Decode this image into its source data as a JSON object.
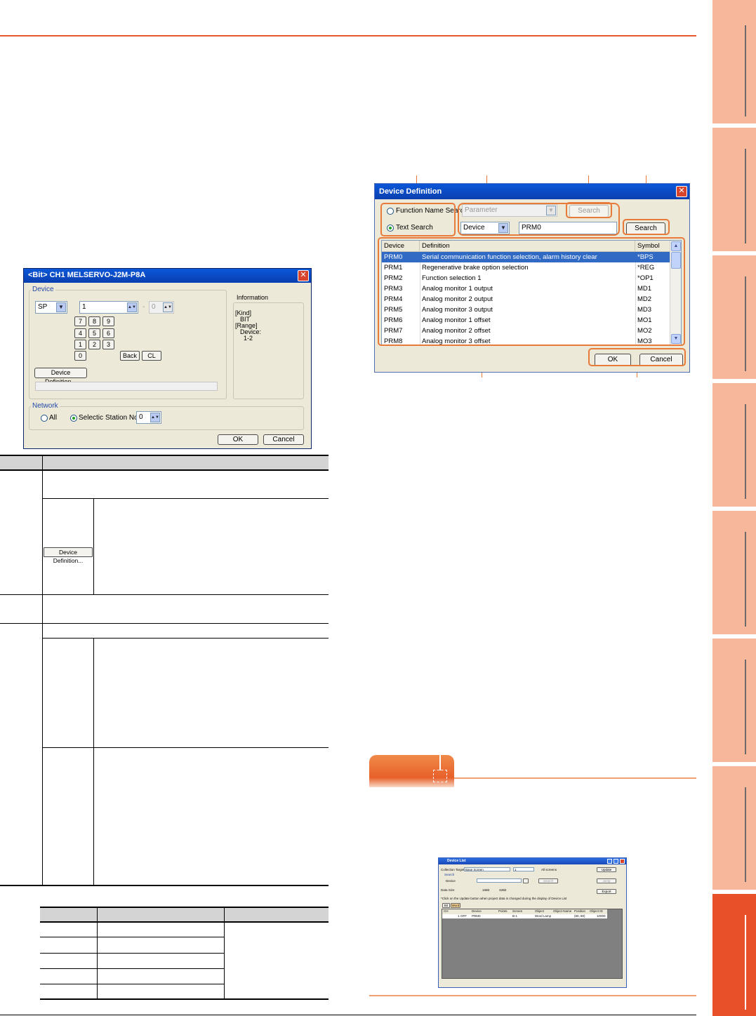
{
  "bit_dialog": {
    "title": "<Bit> CH1 MELSERVO-J2M-P8A",
    "device_group_label": "Device",
    "device_type": "SP",
    "device_number": "1",
    "range_to_separator": "-",
    "range_to_value": "0",
    "keypad": [
      "7",
      "8",
      "9",
      "4",
      "5",
      "6",
      "1",
      "2",
      "3",
      "0"
    ],
    "back_label": "Back",
    "clear_label": "CL",
    "device_definition_label": "Device Definition...",
    "information_label": "Information",
    "info_lines": [
      "[Kind]",
      "BIT",
      "[Range]",
      "Device:",
      "1-2"
    ],
    "network_group_label": "Network",
    "network_all_label": "All",
    "network_select_label": "Selectic",
    "station_label": "Station No.:",
    "station_value": "0",
    "ok_label": "OK",
    "cancel_label": "Cancel"
  },
  "table": {
    "device_definition_button": "Device Definition..."
  },
  "device_definition_dialog": {
    "title": "Device Definition",
    "function_name_search_label": "Function Name Search",
    "text_search_label": "Text Search",
    "parameter_placeholder": "Parameter",
    "search_label_1": "Search",
    "search_label_2": "Search",
    "device_dropdown": "Device",
    "search_text": "PRM0",
    "columns": [
      "Device",
      "Definition",
      "Symbol"
    ],
    "rows": [
      {
        "device": "PRM0",
        "definition": "Serial communication function selection, alarm history clear",
        "symbol": "*BPS"
      },
      {
        "device": "PRM1",
        "definition": "Regenerative brake option selection",
        "symbol": "*REG"
      },
      {
        "device": "PRM2",
        "definition": "Function selection 1",
        "symbol": "*OP1"
      },
      {
        "device": "PRM3",
        "definition": "Analog monitor 1 output",
        "symbol": "MD1"
      },
      {
        "device": "PRM4",
        "definition": "Analog monitor 2 output",
        "symbol": "MD2"
      },
      {
        "device": "PRM5",
        "definition": "Analog monitor 3 output",
        "symbol": "MD3"
      },
      {
        "device": "PRM6",
        "definition": "Analog monitor 1 offset",
        "symbol": "MO1"
      },
      {
        "device": "PRM7",
        "definition": "Analog monitor 2 offset",
        "symbol": "MO2"
      },
      {
        "device": "PRM8",
        "definition": "Analog monitor 3 offset",
        "symbol": "MO3"
      }
    ],
    "ok_label": "OK",
    "cancel_label": "Cancel"
  },
  "device_list_window": {
    "title": "Device List",
    "collection_target_label": "Collection Target",
    "collection_target_value": "Base Screen",
    "screen_no": "1",
    "all_screens_label": "All screens",
    "search_group_label": "Search",
    "device_label": "Device",
    "search_label": "Search",
    "data_size_label": "Data Size",
    "size_16": "16Bit",
    "size_32": "32Bit",
    "update_label": "Update",
    "jump_label": "Jump",
    "export_label": "Export",
    "note": "*Click on the Update button when project data is changed during the display of Device List",
    "tabs": [
      "Bit",
      "Word"
    ],
    "columns": [
      "CH",
      "",
      "Device",
      "Points",
      "Screen",
      "Object",
      "Object Name",
      "Position",
      "Object ID"
    ],
    "row": [
      "1",
      "OFF",
      "PRM0",
      "",
      "B-1",
      "Word Lamp",
      "",
      "(80, 80)",
      "10000"
    ]
  }
}
